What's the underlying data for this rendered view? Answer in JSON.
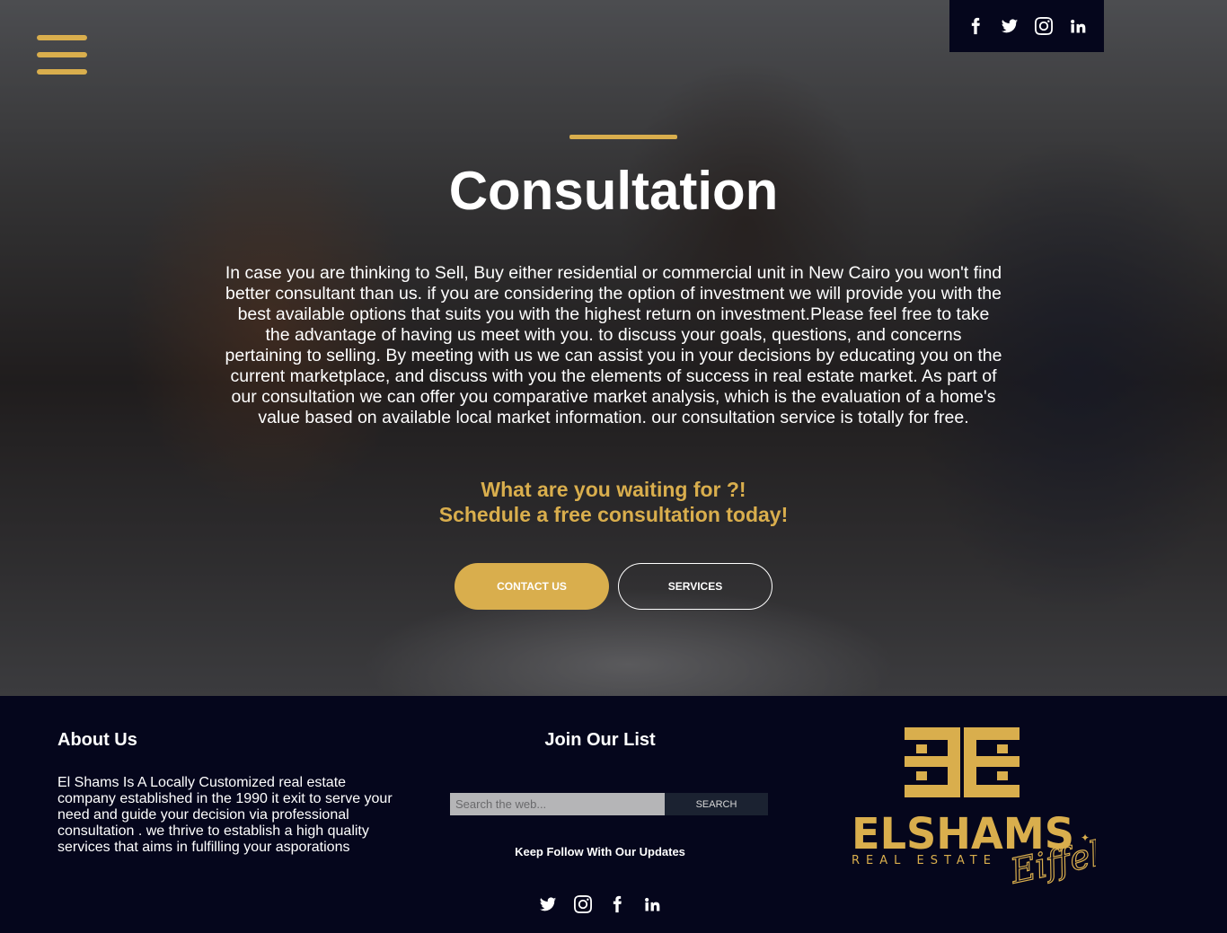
{
  "header": {
    "menu_icon": "hamburger-icon",
    "social": [
      "facebook-icon",
      "twitter-icon",
      "instagram-icon",
      "linkedin-icon"
    ]
  },
  "hero": {
    "title": "Consultation",
    "description": "In case you are thinking to Sell, Buy either residential or commercial unit in New Cairo you won't find better consultant than us. if you are considering the option of investment we will provide you with the best available options that suits you with the highest return on investment.Please feel free to take the advantage of having us meet with you. to discuss your goals, questions, and concerns pertaining to selling. By meeting with us we can assist you in your decisions by educating you on the current marketplace, and discuss with you the elements of success in real estate market. As part of our consultation we can offer you comparative market analysis, which is the evaluation of a home's value based on available local market information. our consultation service is totally for free.",
    "cta_line1": "What are you waiting for ?!",
    "cta_line2": "Schedule a free consultation today!",
    "contact_button": "CONTACT US",
    "services_button": "SERVICES"
  },
  "footer": {
    "about_title": "About Us",
    "about_text": "El Shams Is A Locally Customized real estate company established in the 1990 it exit to serve your need and guide your decision via professional consultation . we thrive to establish a high quality services that aims in fulfilling your asporations",
    "join_title": "Join Our List",
    "search_placeholder": "Search the web...",
    "search_button": "SEARCH",
    "follow_text": "Keep Follow With Our Updates",
    "social": [
      "twitter-icon",
      "instagram-icon",
      "facebook-icon",
      "linkedin-icon"
    ],
    "logo": {
      "name": "ELSHAMS",
      "subtitle": "REAL ESTATE",
      "script": "Eiffel"
    }
  },
  "colors": {
    "accent": "#d9ae4d",
    "navy": "#05061c"
  }
}
